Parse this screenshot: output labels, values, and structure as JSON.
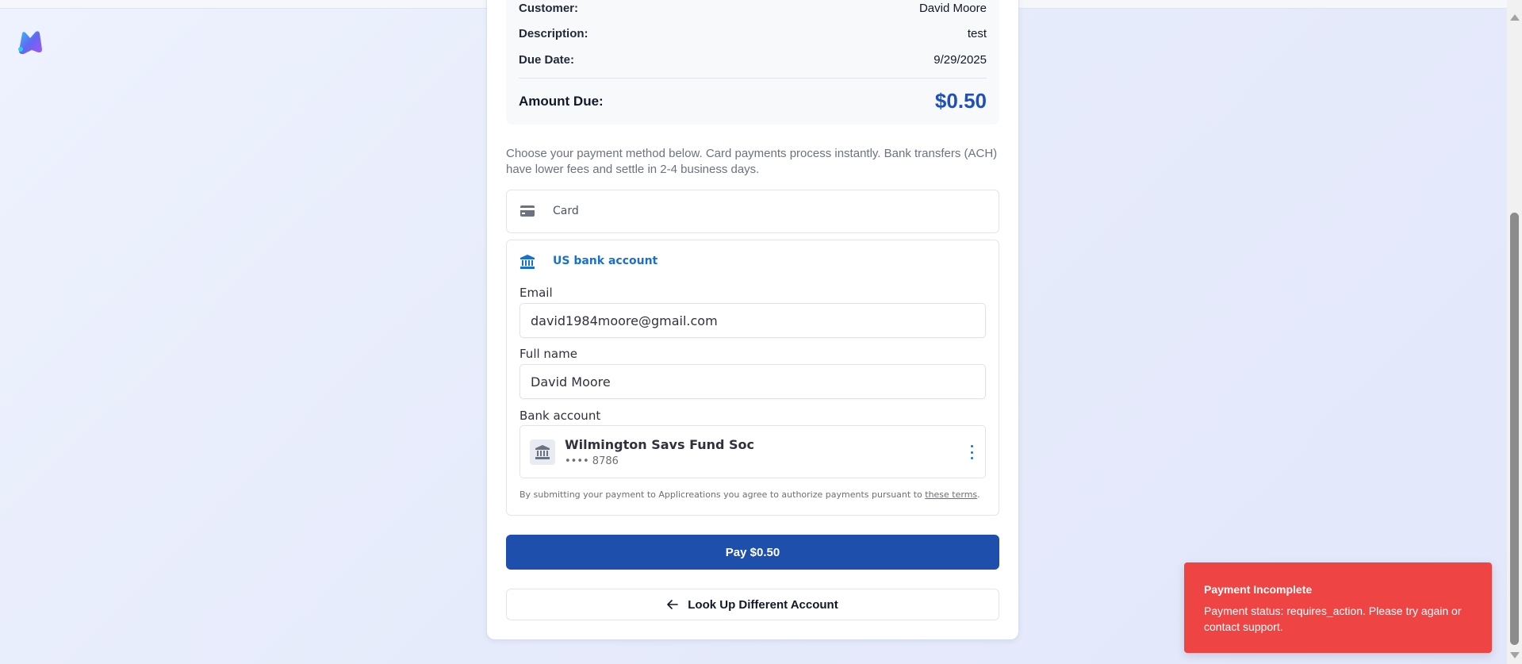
{
  "summary": {
    "customer_label": "Customer:",
    "customer_value": "David Moore",
    "description_label": "Description:",
    "description_value": "test",
    "due_date_label": "Due Date:",
    "due_date_value": "9/29/2025",
    "amount_label": "Amount Due:",
    "amount_value": "$0.50"
  },
  "intro_text": "Choose your payment method below. Card payments process instantly. Bank transfers (ACH) have lower fees and settle in 2-4 business days.",
  "payment_methods": {
    "card_label": "Card",
    "bank_label": "US bank account"
  },
  "bank_form": {
    "email_label": "Email",
    "email_value": "david1984moore@gmail.com",
    "name_label": "Full name",
    "name_value": "David Moore",
    "bank_label": "Bank account",
    "bank_name": "Wilmington Savs Fund Soc",
    "bank_number": "•••• 8786",
    "terms_prefix": "By submitting your payment to Applicreations you agree to authorize payments pursuant to",
    "terms_link": "these terms",
    "terms_suffix": "."
  },
  "actions": {
    "pay_label": "Pay $0.50",
    "lookup_label": "Look Up Different Account"
  },
  "toast": {
    "title": "Payment Incomplete",
    "message": "Payment status: requires_action. Please try again or contact support."
  },
  "colors": {
    "primary": "#1e4fad",
    "amount": "#1e4fbf",
    "bank_accent": "#1a6fd1",
    "toast": "#ef4444"
  },
  "icons": {
    "logo": "app-logo",
    "card": "credit-card-icon",
    "bank": "bank-icon",
    "more": "more-vertical-icon",
    "back": "arrow-left-icon"
  }
}
